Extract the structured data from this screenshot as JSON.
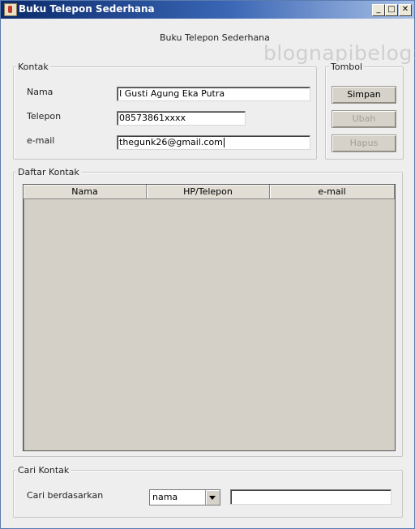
{
  "window": {
    "title": "Buku Telepon Sederhana",
    "controls": {
      "minimize": "_",
      "maximize": "□",
      "close": "✕"
    },
    "colors": {
      "titlebar_start": "#0a2a6b",
      "titlebar_end": "#a9c0e6",
      "background": "#eeeeee"
    }
  },
  "header": {
    "title": "Buku Telepon Sederhana"
  },
  "watermark": "blognapibelog:",
  "kontak": {
    "title": "Kontak",
    "fields": [
      {
        "label": "Nama",
        "value": "I Gusti Agung Eka Putra"
      },
      {
        "label": "Telepon",
        "value": "08573861xxxx"
      },
      {
        "label": "e-mail",
        "value": "thegunk26@gmail.com"
      }
    ]
  },
  "tombol": {
    "title": "Tombol",
    "buttons": [
      {
        "label": "Simpan",
        "enabled": true
      },
      {
        "label": "Ubah",
        "enabled": false
      },
      {
        "label": "Hapus",
        "enabled": false
      }
    ]
  },
  "daftar": {
    "title": "Daftar Kontak",
    "columns": [
      "Nama",
      "HP/Telepon",
      "e-mail"
    ],
    "rows": []
  },
  "cari": {
    "title": "Cari Kontak",
    "label": "Cari berdasarkan",
    "combo_value": "nama",
    "query": ""
  }
}
